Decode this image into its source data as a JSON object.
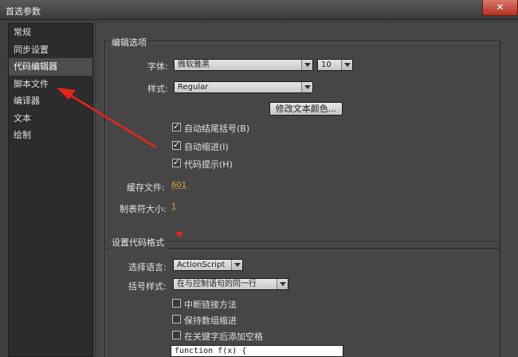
{
  "window": {
    "title": "首选参数",
    "close_glyph": "✕"
  },
  "sidebar": {
    "items": [
      {
        "label": "常规"
      },
      {
        "label": "同步设置"
      },
      {
        "label": "代码编辑器",
        "selected": true
      },
      {
        "label": "脚本文件"
      },
      {
        "label": "编译器"
      },
      {
        "label": "文本"
      },
      {
        "label": "绘制"
      }
    ]
  },
  "edit_options": {
    "group_label": "编辑选项",
    "font_label": "字体:",
    "font_value": "微软雅黑",
    "size_value": "10",
    "style_label": "样式:",
    "style_value": "Regular",
    "modify_color_button": "修改文本颜色...",
    "auto_close_brackets": {
      "label": "自动结尾括号(B)",
      "checked": true
    },
    "auto_indent": {
      "label": "自动缩进(I)",
      "checked": true
    },
    "code_hints": {
      "label": "代码提示(H)",
      "checked": true
    },
    "cache_files_label": "缓存文件:",
    "cache_files_value": "601",
    "tab_size_label": "制表符大小:",
    "tab_size_value": "1"
  },
  "format_code": {
    "group_label": "设置代码格式",
    "language_label": "选择语言:",
    "language_value": "ActionScript",
    "bracket_style_label": "括号样式:",
    "bracket_style_value": "在与控制语句的同一行",
    "break_chained_methods": {
      "label": "中断链接方法",
      "checked": false
    },
    "preserve_array_indent": {
      "label": "保持数组缩进",
      "checked": false
    },
    "space_after_keyword": {
      "label": "在关键字后添加空格",
      "checked": false
    },
    "preview_text": "function f(x) {"
  },
  "annotation": {
    "color": "#e8231a"
  }
}
